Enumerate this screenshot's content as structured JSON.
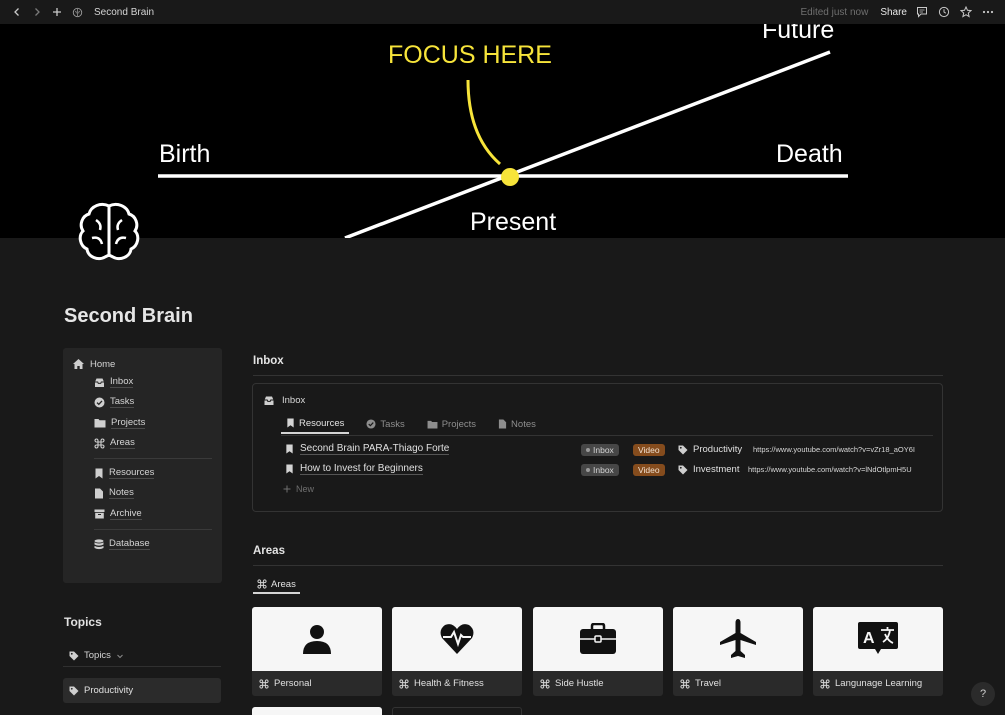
{
  "topbar": {
    "title": "Second Brain",
    "edited": "Edited just now",
    "share": "Share"
  },
  "cover": {
    "focus": "FOCUS HERE",
    "future": "Future",
    "birth": "Birth",
    "death": "Death",
    "present": "Present",
    "accent": "#f7e43a"
  },
  "page": {
    "title": "Second Brain"
  },
  "sidebar": {
    "home": "Home",
    "items": [
      "Inbox",
      "Tasks",
      "Projects",
      "Areas",
      "Resources",
      "Notes",
      "Archive",
      "Database"
    ]
  },
  "topics": {
    "heading": "Topics",
    "selector": "Topics",
    "items": [
      "Productivity"
    ]
  },
  "inbox": {
    "heading": "Inbox",
    "view_title": "Inbox",
    "tabs": [
      "Resources",
      "Tasks",
      "Projects",
      "Notes"
    ],
    "rows": [
      {
        "name": "Second Brain PARA-Thiago Forte",
        "status": "Inbox",
        "type": "Video",
        "tag": "Productivity",
        "url": "https://www.youtube.com/watch?v=vZr18_aOY6I"
      },
      {
        "name": "How to Invest for Beginners",
        "status": "Inbox",
        "type": "Video",
        "tag": "Investment",
        "url": "https://www.youtube.com/watch?v=lNdOtlpmH5U"
      }
    ],
    "new_label": "New"
  },
  "areas": {
    "heading": "Areas",
    "tab": "Areas",
    "cards": [
      {
        "label": "Personal",
        "icon": "person-icon"
      },
      {
        "label": "Health & Fitness",
        "icon": "heart-pulse-icon"
      },
      {
        "label": "Side Hustle",
        "icon": "briefcase-icon"
      },
      {
        "label": "Travel",
        "icon": "airplane-icon"
      },
      {
        "label": "Langunage Learning",
        "icon": "translate-icon"
      }
    ]
  },
  "help": "?"
}
